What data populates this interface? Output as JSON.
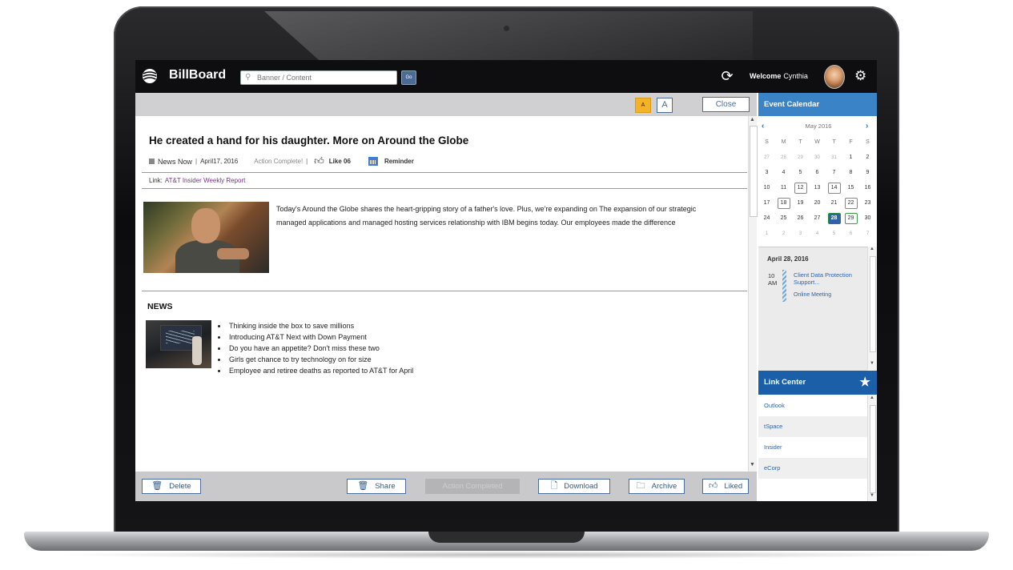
{
  "app": {
    "title": "BillBoard",
    "search_placeholder": "Banner / Content",
    "go_label": "Go",
    "welcome_label": "Welcome",
    "user_name": "Cynthia"
  },
  "toolbar": {
    "font_small": "A",
    "font_large": "A",
    "close_label": "Close"
  },
  "article": {
    "headline": "He created a hand for his daughter. More on Around the Globe",
    "source": "News Now",
    "date": "April17, 2016",
    "status": "Action Complete!",
    "like_label": "Like 06",
    "reminder_label": "Reminder",
    "link_label": "Link:",
    "link_text": "AT&T Insider Weekly Report",
    "body": "Today's Around the Globe shares the heart-gripping story of a father's love. Plus, we're expanding on The expansion of our strategic managed applications and managed hosting services relationship with IBM begins today. Our employees made the difference"
  },
  "news": {
    "title": "NEWS",
    "items": [
      "Thinking inside the box to save millions",
      "Introducing AT&T Next with Down Payment",
      "Do you have an appetite? Don't miss these two",
      "Girls get chance to try technology on for size",
      "Employee and retiree deaths as reported to AT&T for April"
    ]
  },
  "actions": {
    "delete": "Delete",
    "share": "Share",
    "completed": "Action Completed",
    "download": "Download",
    "archive": "Archive",
    "liked": "Liked"
  },
  "calendar": {
    "title": "Event Calendar",
    "month": "May 2016",
    "prev": "‹",
    "next": "›",
    "days_of_week": [
      "S",
      "M",
      "T",
      "W",
      "T",
      "F",
      "S"
    ],
    "weeks": [
      [
        "27",
        "28",
        "29",
        "30",
        "31",
        "1",
        "2"
      ],
      [
        "3",
        "4",
        "5",
        "6",
        "7",
        "8",
        "9"
      ],
      [
        "10",
        "11",
        "12",
        "13",
        "14",
        "15",
        "16"
      ],
      [
        "17",
        "18",
        "19",
        "20",
        "21",
        "22",
        "23"
      ],
      [
        "24",
        "25",
        "26",
        "27",
        "28",
        "29",
        "30"
      ],
      [
        "1",
        "2",
        "3",
        "4",
        "5",
        "6",
        "7"
      ]
    ],
    "event_date": "April 28, 2016",
    "event_time_hour": "10",
    "event_time_ampm": "AM",
    "event_title": "Client Data Protection Support...",
    "event_subtitle": "Online Meeting"
  },
  "links": {
    "title": "Link Center",
    "items": [
      "Outlook",
      "tSpace",
      "Insider",
      "eCorp"
    ]
  },
  "colors": {
    "accent": "#3a83c7",
    "link_header": "#1a5fa8",
    "today": "#2f62a8",
    "highlight": "#f3b328"
  }
}
